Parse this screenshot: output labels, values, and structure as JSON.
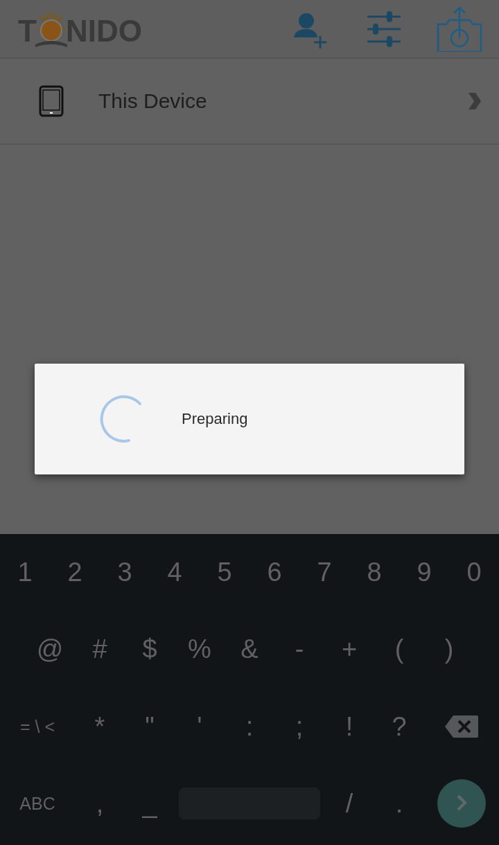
{
  "app_bar": {
    "logo": {
      "before": "T",
      "after": "NIDO"
    }
  },
  "list": [
    {
      "label": "This Device"
    }
  ],
  "dialog": {
    "message": "Preparing"
  },
  "keyboard": {
    "rows": [
      {
        "keys": [
          {
            "kind": "char",
            "label": "1"
          },
          {
            "kind": "char",
            "label": "2"
          },
          {
            "kind": "char",
            "label": "3"
          },
          {
            "kind": "char",
            "label": "4"
          },
          {
            "kind": "char",
            "label": "5"
          },
          {
            "kind": "char",
            "label": "6"
          },
          {
            "kind": "char",
            "label": "7"
          },
          {
            "kind": "char",
            "label": "8"
          },
          {
            "kind": "char",
            "label": "9"
          },
          {
            "kind": "char",
            "label": "0"
          }
        ]
      },
      {
        "keys": [
          {
            "kind": "char",
            "label": "@"
          },
          {
            "kind": "char",
            "label": "#"
          },
          {
            "kind": "char",
            "label": "$"
          },
          {
            "kind": "char",
            "label": "%"
          },
          {
            "kind": "char",
            "label": "&"
          },
          {
            "kind": "char",
            "label": "-"
          },
          {
            "kind": "char",
            "label": "+"
          },
          {
            "kind": "char",
            "label": "("
          },
          {
            "kind": "char",
            "label": ")"
          }
        ]
      },
      {
        "keys": [
          {
            "kind": "wide",
            "label": "= \\ <"
          },
          {
            "kind": "char",
            "label": "*"
          },
          {
            "kind": "char",
            "label": "\""
          },
          {
            "kind": "char",
            "label": "'"
          },
          {
            "kind": "char",
            "label": ":"
          },
          {
            "kind": "char",
            "label": ";"
          },
          {
            "kind": "char",
            "label": "!"
          },
          {
            "kind": "char",
            "label": "?"
          },
          {
            "kind": "backspace"
          }
        ]
      },
      {
        "keys": [
          {
            "kind": "wide",
            "label": "ABC"
          },
          {
            "kind": "char",
            "label": ","
          },
          {
            "kind": "char",
            "label": "_"
          },
          {
            "kind": "space"
          },
          {
            "kind": "char",
            "label": "/"
          },
          {
            "kind": "char",
            "label": "."
          },
          {
            "kind": "enter"
          }
        ]
      }
    ]
  }
}
